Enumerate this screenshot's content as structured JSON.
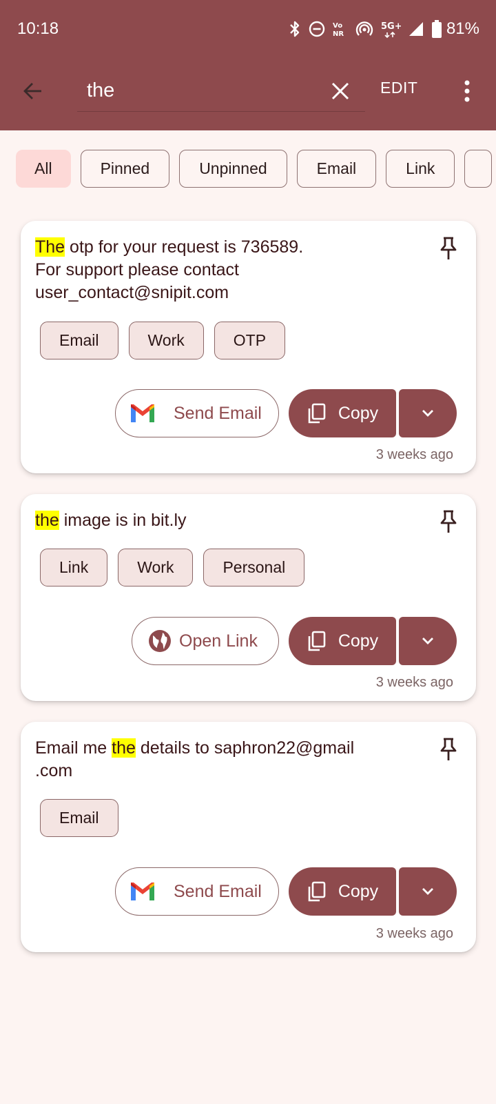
{
  "status_bar": {
    "time": "10:18",
    "battery": "81%",
    "network": "5G+",
    "icons": [
      "bluetooth-icon",
      "do-not-disturb-icon",
      "vonr-icon",
      "hotspot-icon",
      "5g-icon",
      "signal-icon",
      "battery-icon"
    ]
  },
  "app_bar": {
    "search_value": "the",
    "edit_label": "EDIT",
    "background": "#8e4a4d"
  },
  "filters": {
    "items": [
      "All",
      "Pinned",
      "Unpinned",
      "Email",
      "Link"
    ],
    "selected": "All"
  },
  "cards": [
    {
      "text_highlight": "The",
      "text_rest": " otp for your request is 736589.\nFor support please contact\nuser_contact@snipit.com",
      "tags": [
        "Email",
        "Work",
        "OTP"
      ],
      "action_label": "Send Email",
      "action_icon": "gmail-icon",
      "copy_label": "Copy",
      "time_ago": "3 weeks ago"
    },
    {
      "text_highlight": "the",
      "text_rest": " image is in bit.ly",
      "tags": [
        "Link",
        "Work",
        "Personal"
      ],
      "action_label": "Open Link",
      "action_icon": "globe-icon",
      "copy_label": "Copy",
      "time_ago": "3 weeks ago"
    },
    {
      "text_before": "Email me ",
      "text_highlight": "the",
      "text_rest": " details to saphron22@gmail\n.com",
      "tags": [
        "Email"
      ],
      "action_label": "Send Email",
      "action_icon": "gmail-icon",
      "copy_label": "Copy",
      "time_ago": "3 weeks ago"
    }
  ],
  "colors": {
    "primary": "#8e4a4d",
    "highlight": "#ffff00",
    "background": "#fdf4f2",
    "selected_chip": "#fdd9d7"
  }
}
